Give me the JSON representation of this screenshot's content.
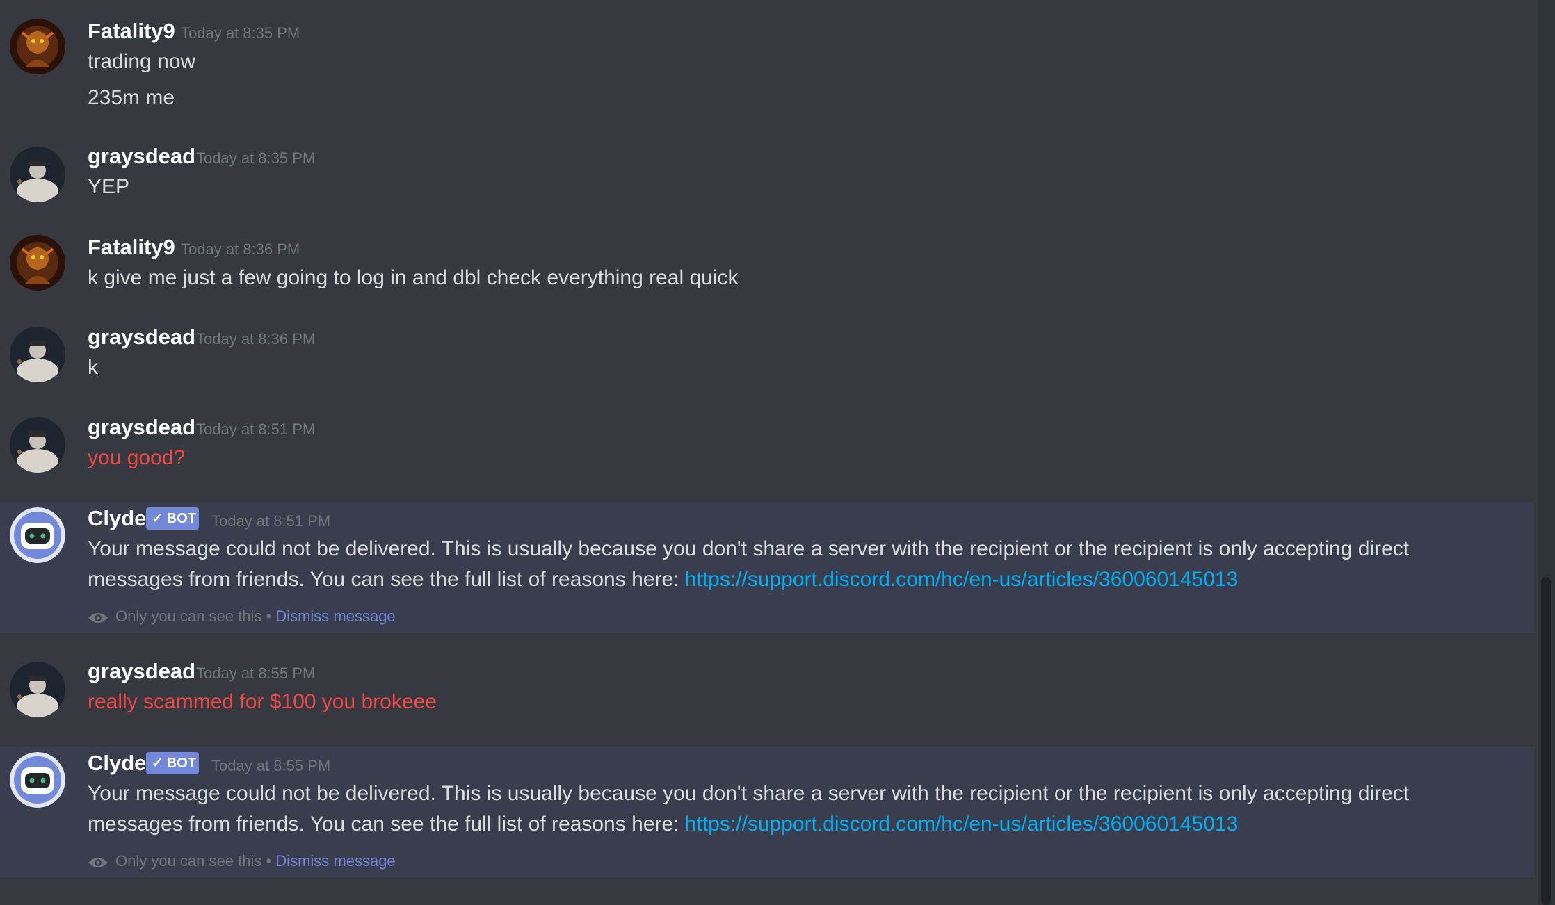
{
  "messages": [
    {
      "author": "Fatality9",
      "timestamp": "Today at 8:35 PM",
      "lines": [
        "trading now",
        "235m me"
      ],
      "avatar_icon": "fatality-avatar-icon"
    },
    {
      "author": "graysdead",
      "timestamp": "Today at 8:35 PM",
      "lines": [
        "YEP"
      ],
      "avatar_icon": "graysdead-avatar-icon"
    },
    {
      "author": "Fatality9",
      "timestamp": "Today at 8:36 PM",
      "lines": [
        "k give me just a few going to log in and dbl check everything real quick"
      ],
      "avatar_icon": "fatality-avatar-icon"
    },
    {
      "author": "graysdead",
      "timestamp": "Today at 8:36 PM",
      "lines": [
        "k"
      ],
      "avatar_icon": "graysdead-avatar-icon"
    },
    {
      "author": "graysdead",
      "timestamp": "Today at 8:51 PM",
      "lines": [
        "you good?"
      ],
      "failed": true,
      "avatar_icon": "graysdead-avatar-icon"
    },
    {
      "author": "Clyde",
      "bot_tag": "BOT",
      "timestamp": "Today at 8:51 PM",
      "text_line1": "Your message could not be delivered. This is usually because you don't share a server with the recipient or the recipient is only accepting direct",
      "text_line2": "messages from friends. You can see the full list of reasons here: ",
      "link": "https://support.discord.com/hc/en-us/articles/360060145013",
      "note": "Only you can see this",
      "separator": "•",
      "dismiss": "Dismiss message",
      "avatar_icon": "clyde-robot-icon"
    },
    {
      "author": "graysdead",
      "timestamp": "Today at 8:55 PM",
      "lines": [
        "really scammed for $100 you brokeee"
      ],
      "failed": true,
      "avatar_icon": "graysdead-avatar-icon"
    },
    {
      "author": "Clyde",
      "bot_tag": "BOT",
      "timestamp": "Today at 8:55 PM",
      "text_line1": "Your message could not be delivered. This is usually because you don't share a server with the recipient or the recipient is only accepting direct",
      "text_line2": "messages from friends. You can see the full list of reasons here: ",
      "link": "https://support.discord.com/hc/en-us/articles/360060145013",
      "note": "Only you can see this",
      "separator": "•",
      "dismiss": "Dismiss message",
      "avatar_icon": "clyde-robot-icon"
    }
  ],
  "colors": {
    "background": "#36393f",
    "ephemeral_background": "#393d4e",
    "username": "#ffffff",
    "timestamp": "#72767d",
    "message_text": "#dcddde",
    "failed_text": "#f04747",
    "link": "#00b0f4",
    "bot_tag": "#7289da",
    "dismiss_link": "#7289da"
  }
}
